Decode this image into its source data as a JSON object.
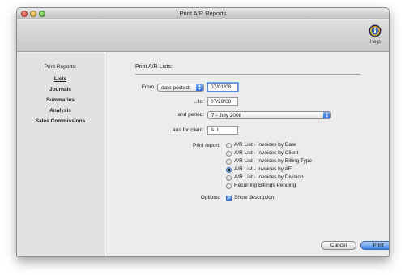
{
  "window": {
    "title": "Print A/R Reports"
  },
  "toolbar": {
    "help_label": "Help",
    "help_icon": "info-icon"
  },
  "sidebar": {
    "header": "Print Reports:",
    "items": [
      {
        "label": "Lists",
        "active": true
      },
      {
        "label": "Journals"
      },
      {
        "label": "Summaries"
      },
      {
        "label": "Analysis"
      },
      {
        "label": "Sales Commissions"
      }
    ]
  },
  "form": {
    "title": "Print A/R Lists:",
    "from_label": "From",
    "date_type": "date posted:",
    "from_date": "07/01/08",
    "to_label": "...to:",
    "to_date": "07/29/08",
    "period_label": "and period:",
    "period_value": "7 - July 2008",
    "client_label": "...and for client:",
    "client_value": "ALL",
    "print_report_label": "Print report:",
    "reports": [
      "A/R List - Invoices by Date",
      "A/R List - Invoices by Client",
      "A/R List - Invoices by Billing Type",
      "A/R List - Invoices by AE",
      "A/R List - Invoices by Division",
      "Recurring Billings Pending"
    ],
    "selected_report_index": 3,
    "options_label": "Options:",
    "show_description_label": "Show description",
    "show_description_checked": true
  },
  "buttons": {
    "cancel": "Cancel",
    "print": "Print"
  },
  "colors": {
    "accent": "#3a76d6",
    "window_bg": "#ececec",
    "sidebar_bg": "#e2e2e2"
  }
}
